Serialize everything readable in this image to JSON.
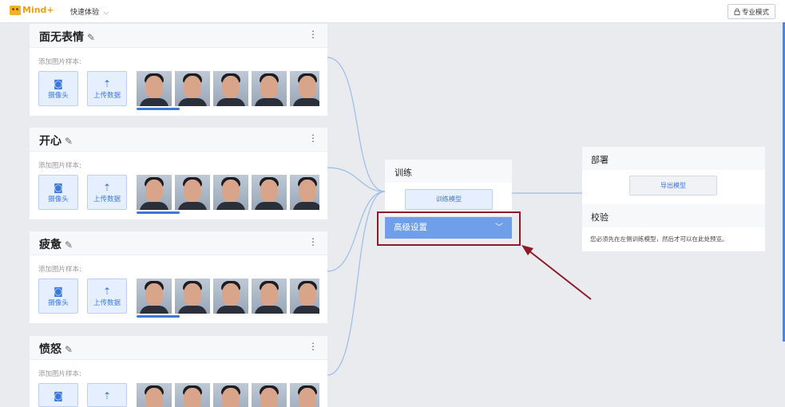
{
  "topbar": {
    "logo_text": "Mind+",
    "quick_label": "快速体验",
    "quick_chevron": "⌵",
    "pro_icon": "lock-icon",
    "pro_label": "专业模式"
  },
  "classes": [
    {
      "name": "面无表情",
      "sample_label": "添加图片样本:",
      "camera_label": "摄像头",
      "upload_label": "上传数据"
    },
    {
      "name": "开心",
      "sample_label": "添加图片样本:",
      "camera_label": "摄像头",
      "upload_label": "上传数据"
    },
    {
      "name": "疲惫",
      "sample_label": "添加图片样本:",
      "camera_label": "摄像头",
      "upload_label": "上传数据"
    },
    {
      "name": "愤怒",
      "sample_label": "添加图片样本:",
      "camera_label": "摄像头",
      "upload_label": "上传数据"
    }
  ],
  "train": {
    "title": "训练",
    "train_button": "训练模型",
    "advanced_label": "高级设置"
  },
  "deploy": {
    "title": "部署",
    "export_button": "导出模型",
    "verify_title": "校验",
    "verify_note": "您必须先在左侧训练模型，然后才可以在此处预览。"
  },
  "colors": {
    "accent": "#3b78d8",
    "advanced_bg": "#6e9fe8",
    "highlight": "#8b1a2b",
    "connector": "#9cbde8"
  }
}
